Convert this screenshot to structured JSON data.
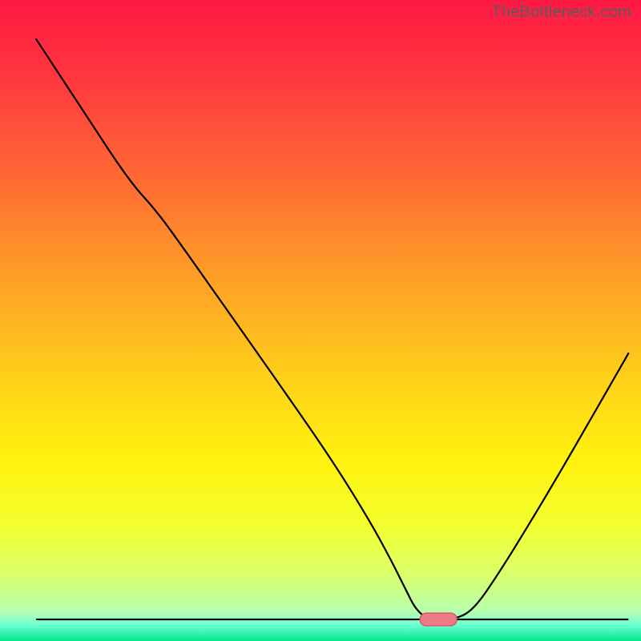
{
  "watermark": "TheBottleneck.com",
  "chart_data": {
    "type": "line",
    "title": "",
    "xlabel": "",
    "ylabel": "",
    "xlim": [
      0,
      100
    ],
    "ylim": [
      0,
      100
    ],
    "gradient_stops": [
      {
        "offset": 0.0,
        "color": "#ff1844"
      },
      {
        "offset": 0.12,
        "color": "#ff373e"
      },
      {
        "offset": 0.28,
        "color": "#ff6a33"
      },
      {
        "offset": 0.44,
        "color": "#ffa126"
      },
      {
        "offset": 0.6,
        "color": "#ffd319"
      },
      {
        "offset": 0.72,
        "color": "#fff20f"
      },
      {
        "offset": 0.82,
        "color": "#f3ff2e"
      },
      {
        "offset": 0.9,
        "color": "#d8ff6e"
      },
      {
        "offset": 0.955,
        "color": "#b5ffb0"
      },
      {
        "offset": 0.975,
        "color": "#6dffd4"
      },
      {
        "offset": 1.0,
        "color": "#00e68c"
      }
    ],
    "series": [
      {
        "name": "bottleneck-curve",
        "x": [
          3.0,
          10.0,
          18.0,
          22.5,
          27.0,
          35.0,
          43.0,
          51.0,
          57.0,
          60.5,
          63.0,
          64.5,
          66.5,
          71.0,
          74.0,
          78.0,
          83.0,
          88.0,
          93.0,
          98.0,
          99.0
        ],
        "y": [
          97.0,
          86.2,
          73.8,
          68.8,
          62.5,
          51.0,
          39.5,
          27.8,
          18.0,
          11.5,
          6.4,
          3.4,
          1.7,
          1.7,
          3.4,
          9.3,
          17.5,
          26.0,
          34.8,
          43.6,
          45.4
        ]
      }
    ],
    "marker": {
      "name": "optimum-pill",
      "cx": 68.2,
      "cy": 1.7,
      "width": 6.0,
      "height": 2.1,
      "fill": "#ed7a84",
      "stroke": "#d94a5a"
    },
    "frame": {
      "left": 3.0,
      "right": 99.0,
      "bottom": 1.7,
      "stroke": "#000000"
    }
  }
}
